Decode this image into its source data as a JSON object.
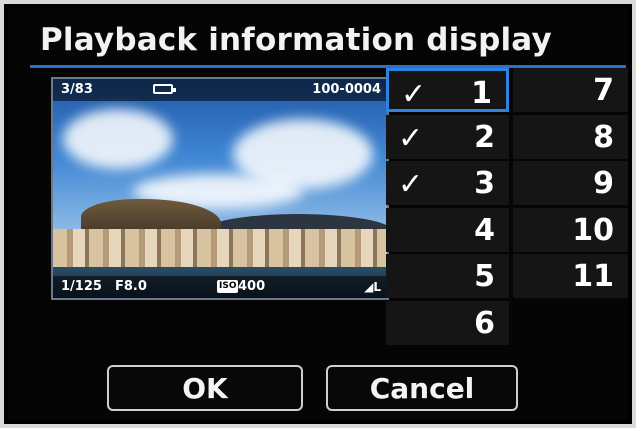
{
  "title": "Playback information display",
  "preview": {
    "frame_counter": "3/83",
    "file_number": "100-0004",
    "shutter": "1/125",
    "aperture": "F8.0",
    "iso_label": "ISO",
    "iso_value": "400",
    "quality": "◢L"
  },
  "items": [
    {
      "number": "1",
      "checked": true,
      "selected": true
    },
    {
      "number": "2",
      "checked": true,
      "selected": false
    },
    {
      "number": "3",
      "checked": true,
      "selected": false
    },
    {
      "number": "4",
      "checked": false,
      "selected": false
    },
    {
      "number": "5",
      "checked": false,
      "selected": false
    },
    {
      "number": "6",
      "checked": false,
      "selected": false
    },
    {
      "number": "7",
      "checked": false,
      "selected": false
    },
    {
      "number": "8",
      "checked": false,
      "selected": false
    },
    {
      "number": "9",
      "checked": false,
      "selected": false
    },
    {
      "number": "10",
      "checked": false,
      "selected": false
    },
    {
      "number": "11",
      "checked": false,
      "selected": false
    }
  ],
  "check_mark": "✓",
  "buttons": {
    "ok": "OK",
    "cancel": "Cancel"
  },
  "colors": {
    "accent": "#2d84e0",
    "title_rule": "#2a6fc9"
  }
}
